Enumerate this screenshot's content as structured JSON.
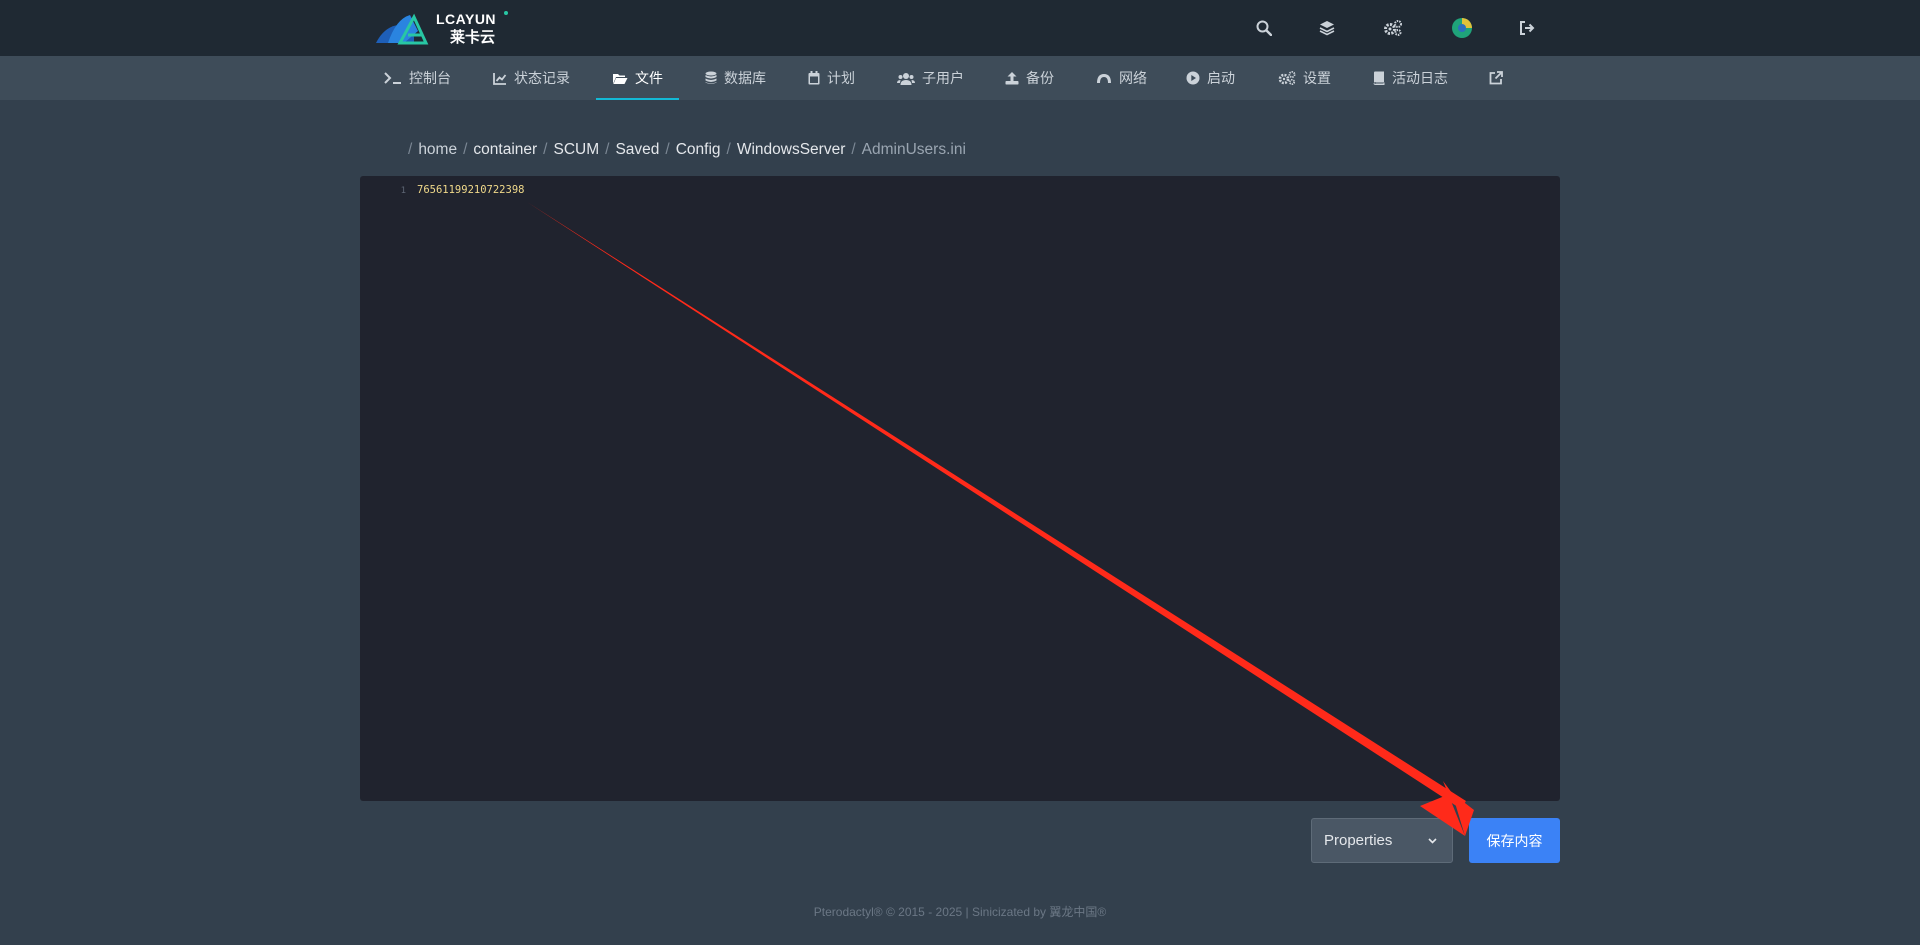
{
  "header": {
    "logo_text": "LCAYUN",
    "logo_subtext": "莱卡云",
    "icons": [
      "search-icon",
      "layers-icon",
      "cogs-icon",
      "avatar",
      "logout-icon"
    ]
  },
  "nav": {
    "items": [
      {
        "label": "控制台",
        "icon": "terminal-icon"
      },
      {
        "label": "状态记录",
        "icon": "chart-icon"
      },
      {
        "label": "文件",
        "icon": "folder-open-icon",
        "active": true
      },
      {
        "label": "数据库",
        "icon": "database-icon"
      },
      {
        "label": "计划",
        "icon": "calendar-icon"
      },
      {
        "label": "子用户",
        "icon": "users-icon"
      },
      {
        "label": "备份",
        "icon": "upload-icon"
      },
      {
        "label": "网络",
        "icon": "network-icon"
      },
      {
        "label": "启动",
        "icon": "play-icon"
      },
      {
        "label": "设置",
        "icon": "cogs-icon"
      },
      {
        "label": "活动日志",
        "icon": "book-icon"
      }
    ],
    "external_icon": "external-link-icon"
  },
  "breadcrumb": {
    "parts": [
      "home",
      "container",
      "SCUM",
      "Saved",
      "Config",
      "WindowsServer"
    ],
    "current": "AdminUsers.ini"
  },
  "editor": {
    "line_number": "1",
    "line_content": "76561199210722398"
  },
  "controls": {
    "mode_select": "Properties",
    "save_label": "保存内容"
  },
  "footer": {
    "text": "Pterodactyl® © 2015 - 2025 | Sinicizated by 翼龙中国®"
  },
  "colors": {
    "accent": "#13b9d5",
    "primary_button": "#3b82f6",
    "annotation_arrow": "#ff2a1a"
  }
}
